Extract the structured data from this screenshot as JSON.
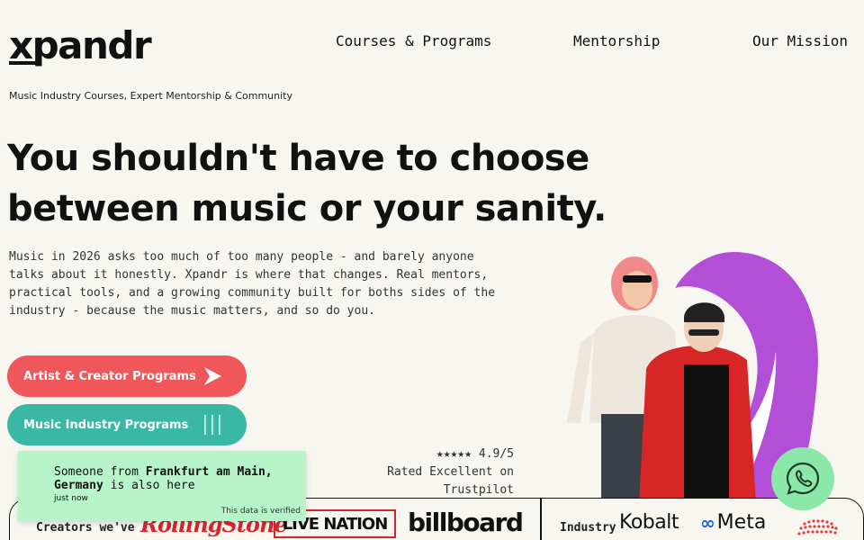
{
  "brand": {
    "name": "xpandr"
  },
  "nav": {
    "courses": "Courses & Programs",
    "mentorship": "Mentorship",
    "mission": "Our Mission"
  },
  "tagline": "Music Industry Courses, Expert Mentorship & Community",
  "hero": {
    "headline_line1": "You shouldn't have to choose",
    "headline_line2": "between music or your sanity.",
    "intro": "Music in 2026 asks too much of too many people - and barely anyone talks about it honestly. Xpandr is where that changes. Real mentors, practical tools, and a growing community built for boths sides of the industry - because the music matters, and so do you."
  },
  "buttons": {
    "artist": "Artist & Creator Programs",
    "industry": "Music Industry Programs"
  },
  "rating": {
    "stars": "★★★★★ 4.9/5",
    "label": "Rated Excellent on Trustpilot"
  },
  "logos": {
    "creators_label": "Creators we've",
    "industry_label": "Industry",
    "rolling_stone": "RollingStone",
    "live_nation": "LIVE NATION",
    "billboard": "billboard",
    "kobalt": "Kobalt",
    "meta": "Meta"
  },
  "toast": {
    "prefix": "Someone from ",
    "city": "Frankfurt am Main, Germany",
    "suffix": " is also here",
    "time": "just now",
    "verified": "This data is verified"
  },
  "colors": {
    "background": "#f7f6f1",
    "artist_button": "#f0575a",
    "industry_button": "#3bb8a5",
    "toast": "#b7f4c9",
    "whatsapp": "#8be8a9",
    "accent_purple": "#b24fd6"
  },
  "icons": {
    "artist_button_icon": "arrow-right-icon",
    "industry_button_icon": "bars-icon",
    "chat": "whatsapp-icon"
  }
}
